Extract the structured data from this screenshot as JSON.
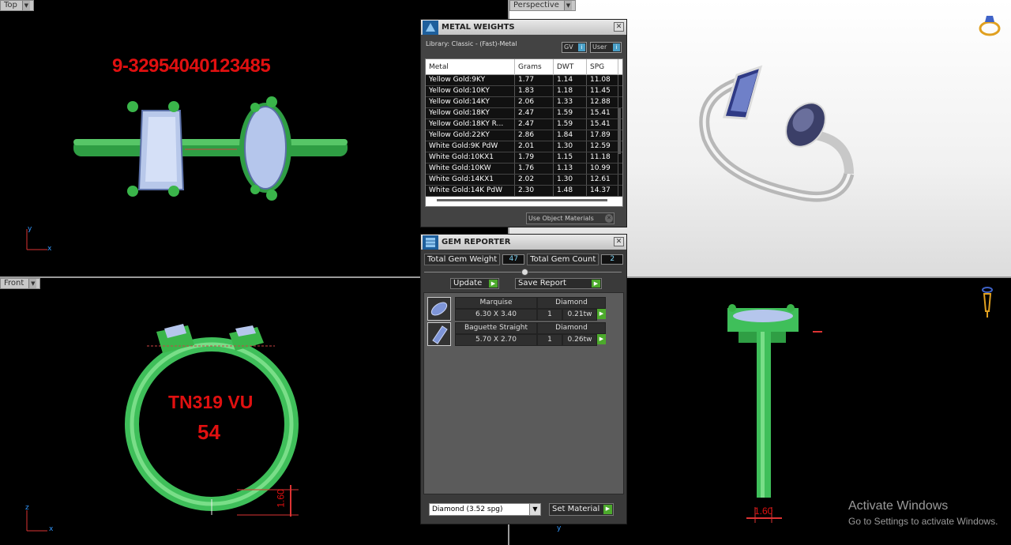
{
  "viewports": {
    "top": {
      "label": "Top",
      "serial_text": "9-32954040123485"
    },
    "perspective": {
      "label": "Perspective"
    },
    "front": {
      "label": "Front",
      "engraving_line1": "TN319 VU",
      "engraving_line2": "54",
      "dim_label": "1.60",
      "axis_up": "z",
      "axis_right": "x"
    },
    "side": {
      "dim_label": "1.60",
      "axis_right": "y"
    },
    "top_axes": {
      "up": "y",
      "right": "x"
    }
  },
  "metal_weights": {
    "title": "METAL WEIGHTS",
    "library": "Library: Classic - (Fast)-Metal",
    "gv_label": "GV",
    "user_label": "User",
    "columns": [
      "Metal",
      "Grams",
      "DWT",
      "SPG"
    ],
    "rows": [
      [
        "Yellow Gold:9KY",
        "1.77",
        "1.14",
        "11.08"
      ],
      [
        "Yellow Gold:10KY",
        "1.83",
        "1.18",
        "11.45"
      ],
      [
        "Yellow Gold:14KY",
        "2.06",
        "1.33",
        "12.88"
      ],
      [
        "Yellow Gold:18KY",
        "2.47",
        "1.59",
        "15.41"
      ],
      [
        "Yellow Gold:18KY R...",
        "2.47",
        "1.59",
        "15.41"
      ],
      [
        "Yellow Gold:22KY",
        "2.86",
        "1.84",
        "17.89"
      ],
      [
        "White Gold:9K PdW",
        "2.01",
        "1.30",
        "12.59"
      ],
      [
        "White Gold:10KX1",
        "1.79",
        "1.15",
        "11.18"
      ],
      [
        "White Gold:10KW",
        "1.76",
        "1.13",
        "10.99"
      ],
      [
        "White Gold:14KX1",
        "2.02",
        "1.30",
        "12.61"
      ],
      [
        "White Gold:14K PdW",
        "2.30",
        "1.48",
        "14.37"
      ]
    ],
    "use_object_materials": "Use Object Materials"
  },
  "gem_reporter": {
    "title": "GEM REPORTER",
    "total_weight_label": "Total Gem Weight",
    "total_weight_value": "47",
    "total_count_label": "Total Gem Count",
    "total_count_value": "2",
    "update_label": "Update",
    "save_label": "Save Report",
    "gems": [
      {
        "shape": "Marquise",
        "type": "Diamond",
        "size": "6.30 X 3.40",
        "qty": "1",
        "weight": "0.21tw"
      },
      {
        "shape": "Baguette Straight",
        "type": "Diamond",
        "size": "5.70 X 2.70",
        "qty": "1",
        "weight": "0.26tw"
      }
    ],
    "material_select": "Diamond    (3.52 spg)",
    "set_material_label": "Set Material"
  },
  "watermark": {
    "line1": "Activate Windows",
    "line2": "Go to Settings to activate Windows."
  }
}
